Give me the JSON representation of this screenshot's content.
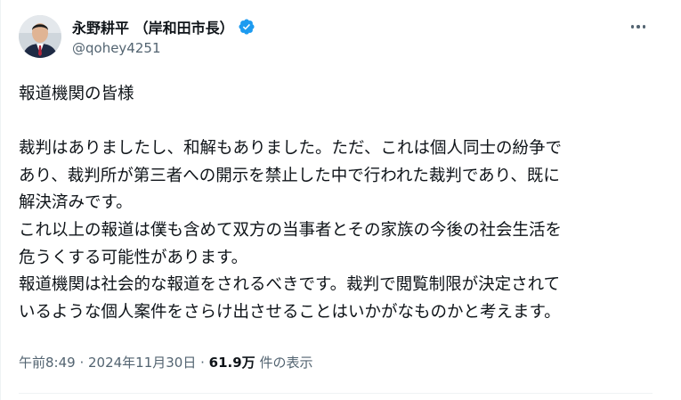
{
  "author": {
    "name": "永野耕平 （岸和田市長）",
    "handle": "@qohey4251",
    "verified": true,
    "avatar_icon": "avatar-photo-icon"
  },
  "post": {
    "lines": [
      "報道機関の皆様",
      "",
      "裁判はありましたし、和解もありました。ただ、これは個人同士の紛争で",
      "あり、裁判所が第三者への開示を禁止した中で行われた裁判であり、既に",
      "解決済みです。",
      "これ以上の報道は僕も含めて双方の当事者とその家族の今後の社会生活を",
      "危うくする可能性があります。",
      "報道機関は社会的な報道をされるべきです。裁判で閲覧制限が決定されて",
      "いるような個人案件をさらけ出させることはいかがなものかと考えます。"
    ]
  },
  "meta": {
    "time": "午前8:49",
    "sep1": " · ",
    "date": "2024年11月30日",
    "sep2": " · ",
    "views_count": "61.9万",
    "views_label": " 件の表示"
  },
  "colors": {
    "text": "#0f1419",
    "secondary": "#536471",
    "verified": "#1d9bf0",
    "divider": "#eff3f4"
  }
}
